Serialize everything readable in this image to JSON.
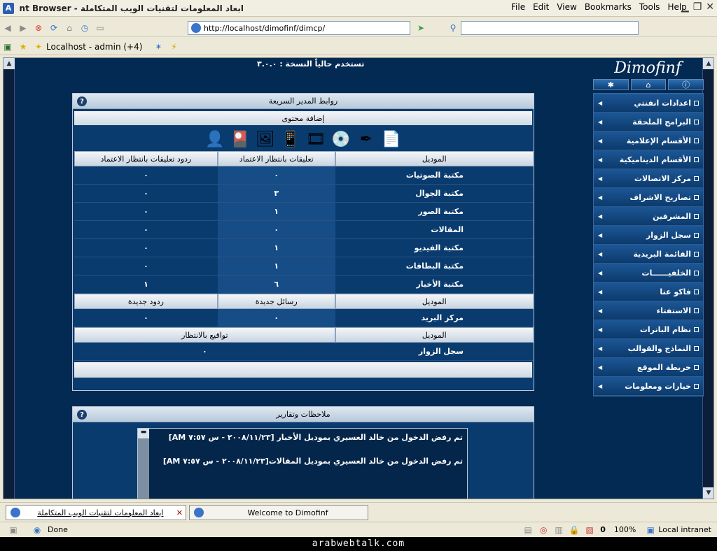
{
  "window": {
    "title": "ابعاد المعلومات لتقنيات الويب المتكاملة - Avant Browser",
    "menu": [
      "File",
      "Edit",
      "View",
      "Bookmarks",
      "Tools",
      "Help"
    ]
  },
  "address": {
    "url": "http://localhost/dimofinf/dimcp/"
  },
  "toolbar2": {
    "localhost_label": "Localhost - admin (+4)"
  },
  "page": {
    "version_text": "تستخدم حالياً النسخة : ٣.٠.٠"
  },
  "quick_links": {
    "title": "روابط المدير السريعة",
    "add_content": "إضافة محتوى",
    "tools": [
      "صفحات",
      "قلم",
      "ملف",
      "هاتف",
      "فيديو",
      "صورة",
      "بطاقة",
      "مستخدم"
    ],
    "table1_headers": [
      "الموديل",
      "تعليقات بانتظار الاعتماد",
      "ردود تعليقات بانتظار الاعتماد"
    ],
    "table1_rows": [
      {
        "module": "مكتبة الصوتيات",
        "pending": "٠",
        "replies": "٠"
      },
      {
        "module": "مكتبة الجوال",
        "pending": "٣",
        "replies": "٠"
      },
      {
        "module": "مكتبة الصور",
        "pending": "١",
        "replies": "٠"
      },
      {
        "module": "المقالات",
        "pending": "٠",
        "replies": "٠"
      },
      {
        "module": "مكتبة الفيديو",
        "pending": "١",
        "replies": "٠"
      },
      {
        "module": "مكتبة البطاقات",
        "pending": "١",
        "replies": "٠"
      },
      {
        "module": "مكتبة الأخبار",
        "pending": "٦",
        "replies": "١"
      }
    ],
    "table2_headers": [
      "الموديل",
      "رسائل جديدة",
      "ردود جديدة"
    ],
    "table2_row": {
      "module": "مركز البريد",
      "messages": "٠",
      "replies": "٠"
    },
    "table3_headers": [
      "الموديل",
      "تواقيع بالانتظار"
    ],
    "table3_row": {
      "module": "سجل الزوار",
      "signatures": "٠"
    }
  },
  "notes": {
    "title": "ملاحظات وتقارير",
    "lines": [
      "تم رفض الدخول من خالد العسيري بموديل الأخبار [٢٠٠٨/١١/٢٣ - س ٧:٥٧ AM]",
      "تم رفض الدخول من خالد العسيري بموديل المقالات[٢٠٠٨/١١/٢٣ - س ٧:٥٧ AM]"
    ]
  },
  "sidebar": {
    "logo": "Dimofinf",
    "items": [
      "اعدادات انفنتي",
      "البرامج الملحقة",
      "الأقسام الإعلامية",
      "الأقسام الديناميكية",
      "مركز الاتصالات",
      "تصاريح الاشراف",
      "المشرفين",
      "سجل الزوار",
      "القائمة البريدية",
      "الخلفيــــــات",
      "فاكو عنا",
      "الاستفتاء",
      "نظام البانرات",
      "النماذج والقوالب",
      "خريطة الموقع",
      "خيارات ومعلومات"
    ]
  },
  "tabs": [
    {
      "label": "ابعاد المعلومات لتقنيات الويب المتكاملة"
    },
    {
      "label": "Welcome to Dimofinf"
    }
  ],
  "status": {
    "text": "Done",
    "count": "0",
    "zoom": "100%",
    "zone": "Local intranet"
  },
  "footer": {
    "text": "arabwebtalk.com"
  }
}
